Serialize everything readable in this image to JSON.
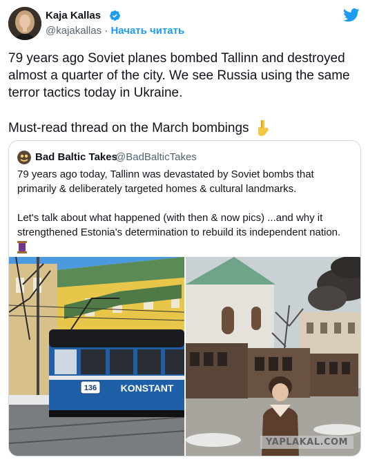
{
  "tweet": {
    "author_name": "Kaja Kallas",
    "handle": "@kajakallas",
    "separator": " · ",
    "follow_label": "Начать читать",
    "text_p1": "79 years ago Soviet planes bombed Tallinn and destroyed almost a quarter of the city. We see Russia using the same terror tactics today in Ukraine.",
    "text_p2": "Must-read thread on the March bombings"
  },
  "quoted_tweet": {
    "author_name": "Bad Baltic Takes",
    "handle": "@BadBalticTakes",
    "text_p1": "79 years ago today, Tallinn was devastated by Soviet bombs that primarily & deliberately targeted homes & cultural landmarks.",
    "text_p2": "Let's talk about what happened (with then & now pics) ...and why it strengthened Estonia's determination to rebuild its independent nation.",
    "tram_sign": "KONSTANT",
    "tram_number": "136"
  },
  "watermark": "YAPLAKAL.COM",
  "icons": {
    "verified": "verified-badge-icon",
    "twitter": "twitter-bird-icon",
    "pointing": "backhand-index-pointing-down-emoji",
    "thread": "spool-of-thread-emoji"
  },
  "colors": {
    "accent": "#1d9bf0",
    "text": "#0f1419",
    "muted": "#536471",
    "border": "#cfd9de"
  }
}
